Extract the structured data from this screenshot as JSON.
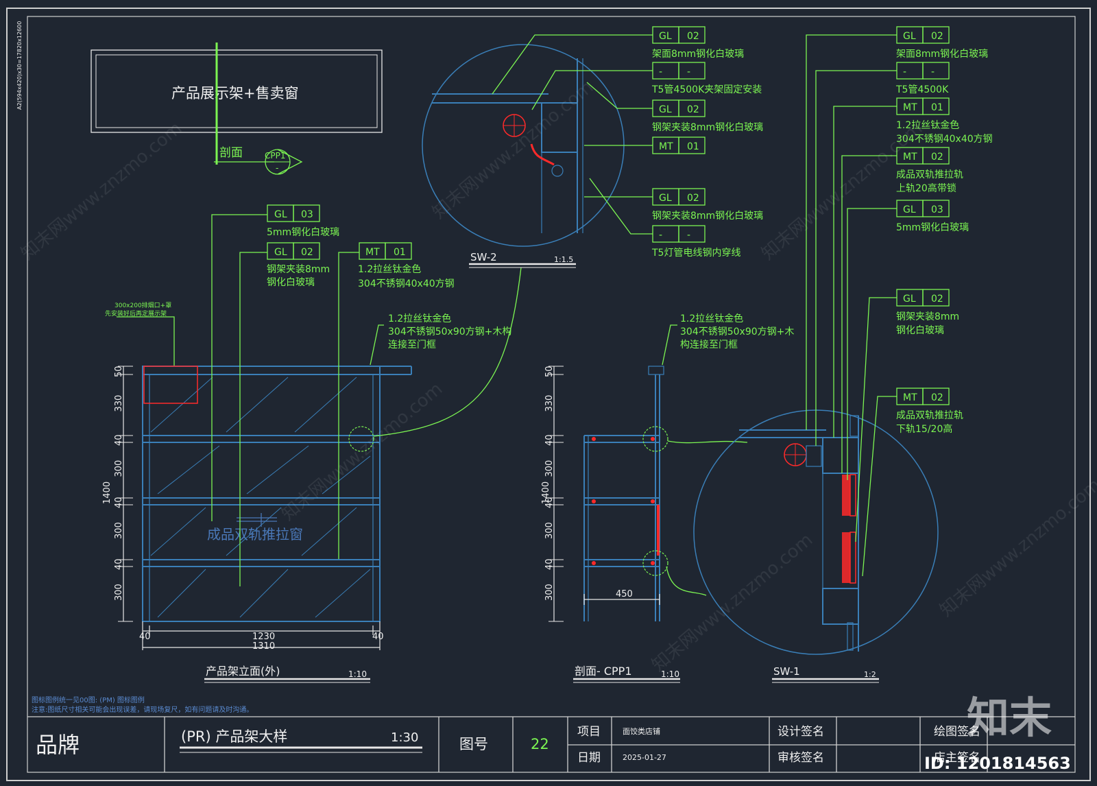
{
  "colors": {
    "background": "#1f2631",
    "leader_green": "#7cf552",
    "frame_blue": "#3a7fb8",
    "accent_red": "#ff2a2a",
    "text_white": "#f0f0f0"
  },
  "sheet_side_note": "A2(594x420)x30=17820x12600",
  "plan": {
    "title": "产品展示架+售卖窗",
    "section_label": "剖面",
    "section_tag": "CPP1",
    "section_tag_sub": "-"
  },
  "elevation": {
    "callouts": [
      {
        "code": "GL",
        "num": "03",
        "text": "5mm钢化白玻璃"
      },
      {
        "code": "GL",
        "num": "02",
        "text": "钢架夹装8mm",
        "text2": "钢化白玻璃"
      },
      {
        "code": "MT",
        "num": "01",
        "text": "1.2拉丝钛金色",
        "text2": "304不锈钢40x40方钢"
      }
    ],
    "beam_note": {
      "line1": "1.2拉丝钛金色",
      "line2": "304不锈钢50x90方钢+木构",
      "line3": "连接至门框"
    },
    "vent_note": {
      "line1": "300x200排烟口+罩",
      "line2": "先安装好后再定展示架"
    },
    "window_label": "成品双轨推拉窗",
    "dims_vertical": [
      "50",
      "330",
      "40",
      "300",
      "40",
      "300",
      "40",
      "300"
    ],
    "total_height": "1400",
    "dims_h": {
      "left": "40",
      "mid": "1230",
      "right": "40",
      "total": "1310"
    },
    "title": "产品架立面(外)",
    "scale": "1:10"
  },
  "section": {
    "beam_note": {
      "line1": "1.2拉丝钛金色",
      "line2": "304不锈钢50x90方钢+木",
      "line3": "构连接至门框"
    },
    "dims_vertical": [
      "50",
      "330",
      "40",
      "300",
      "40",
      "300",
      "40",
      "300"
    ],
    "total_height": "1400",
    "depth": "450",
    "title": "剖面- CPP1",
    "scale": "1:10"
  },
  "sw2": {
    "title": "SW-2",
    "scale": "1:1.5",
    "callouts": [
      {
        "code": "GL",
        "num": "02",
        "text": "架面8mm钢化白玻璃"
      },
      {
        "code": "-",
        "num": "-",
        "text": "T5管4500K夹架固定安装"
      },
      {
        "code": "GL",
        "num": "02",
        "text": "钢架夹装8mm钢化白玻璃"
      },
      {
        "code": "MT",
        "num": "01",
        "text": ""
      },
      {
        "code": "GL",
        "num": "02",
        "text": "钢架夹装8mm钢化白玻璃"
      },
      {
        "code": "-",
        "num": "-",
        "text": "T5灯管电线钢内穿线"
      }
    ]
  },
  "sw1": {
    "title": "SW-1",
    "scale": "1:2",
    "callouts": [
      {
        "code": "GL",
        "num": "02",
        "text": "架面8mm钢化白玻璃"
      },
      {
        "code": "-",
        "num": "-",
        "text": "T5管4500K"
      },
      {
        "code": "MT",
        "num": "01",
        "text": "1.2拉丝钛金色",
        "text2": "304不锈钢40x40方钢"
      },
      {
        "code": "MT",
        "num": "02",
        "text": "成品双轨推拉轨",
        "text2": "上轨20高带锁"
      },
      {
        "code": "GL",
        "num": "03",
        "text": "5mm钢化白玻璃"
      },
      {
        "code": "GL",
        "num": "02",
        "text": "钢架夹装8mm",
        "text2": "钢化白玻璃"
      },
      {
        "code": "MT",
        "num": "02",
        "text": "成品双轨推拉轨",
        "text2": "下轨15/20高"
      }
    ]
  },
  "notes": {
    "line1": "图标图例统一见00图: (PM) 图标图例",
    "line2": "注意:图纸尺寸相关可能会出现误差，请现场复尺，如有问题请及时沟通。"
  },
  "title_block": {
    "brand": "品牌",
    "drawing_title": "(PR) 产品架大样",
    "drawing_scale": "1:30",
    "drawing_no_label": "图号",
    "drawing_no": "22",
    "project_label": "项目",
    "project_value": "面饺类店铺",
    "date_label": "日期",
    "date_value": "2025-01-27",
    "design_sign": "设计签名",
    "review_sign": "审核签名",
    "draw_sign": "绘图签名",
    "owner_sign": "店主签名"
  },
  "watermark": {
    "logo": "知末",
    "id": "ID: 1201814563",
    "diag": "知末网www.znzmo.com"
  }
}
